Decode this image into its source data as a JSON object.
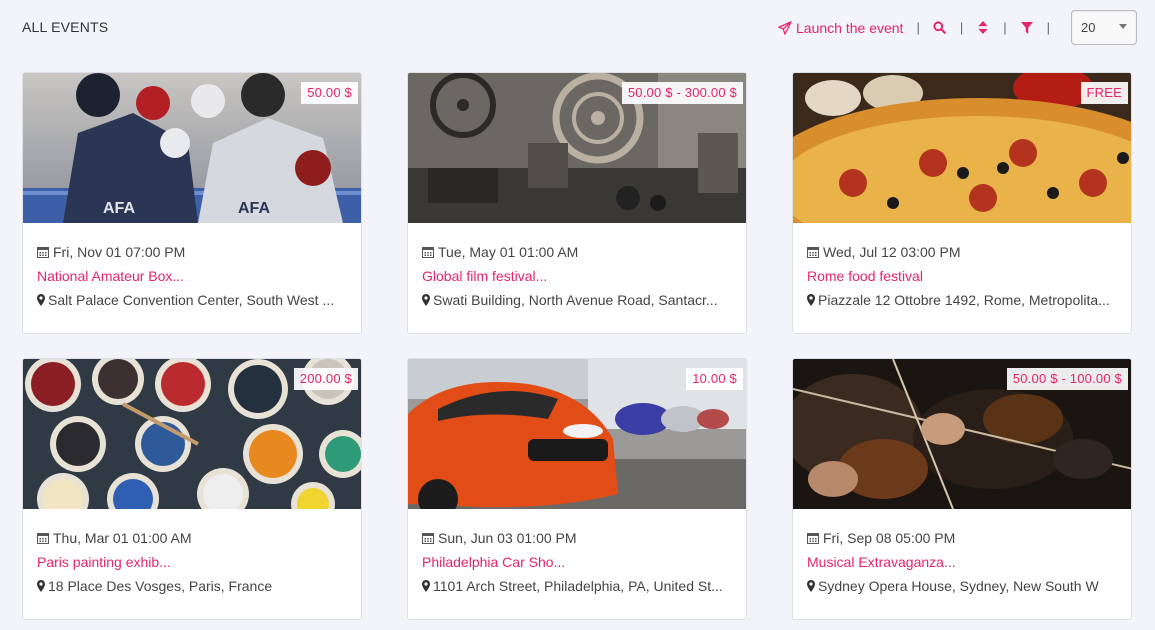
{
  "header": {
    "title": "ALL EVENTS",
    "launch_label": "Launch the event",
    "per_page": "20",
    "icons": [
      "paper-plane-icon",
      "search-icon",
      "sort-icon",
      "filter-icon"
    ]
  },
  "colors": {
    "accent": "#e5256c",
    "background": "#f3f4f9"
  },
  "events": [
    {
      "date": "Fri, Nov 01 07:00 PM",
      "title": "National Amateur Box...",
      "venue": "Salt Palace Convention Center, South West ...",
      "price": "50.00  $"
    },
    {
      "date": "Tue, May 01 01:00 AM",
      "title": "Global film festival...",
      "venue": "Swati Building, North Avenue Road, Santacr...",
      "price": "50.00  $ -  300.00  $"
    },
    {
      "date": "Wed, Jul 12 03:00 PM",
      "title": "Rome food festival",
      "venue": "Piazzale 12 Ottobre 1492, Rome, Metropolita...",
      "price": "FREE"
    },
    {
      "date": "Thu, Mar 01 01:00 AM",
      "title": "Paris painting exhib...",
      "venue": "18 Place Des Vosges, Paris, France",
      "price": "200.00  $"
    },
    {
      "date": "Sun, Jun 03 01:00 PM",
      "title": "Philadelphia Car Sho...",
      "venue": "1101 Arch Street, Philadelphia, PA, United St...",
      "price": "10.00  $"
    },
    {
      "date": "Fri, Sep 08 05:00 PM",
      "title": "Musical Extravaganza...",
      "venue": "Sydney Opera House, Sydney, New South W",
      "price": "50.00  $ -  100.00  $"
    }
  ]
}
